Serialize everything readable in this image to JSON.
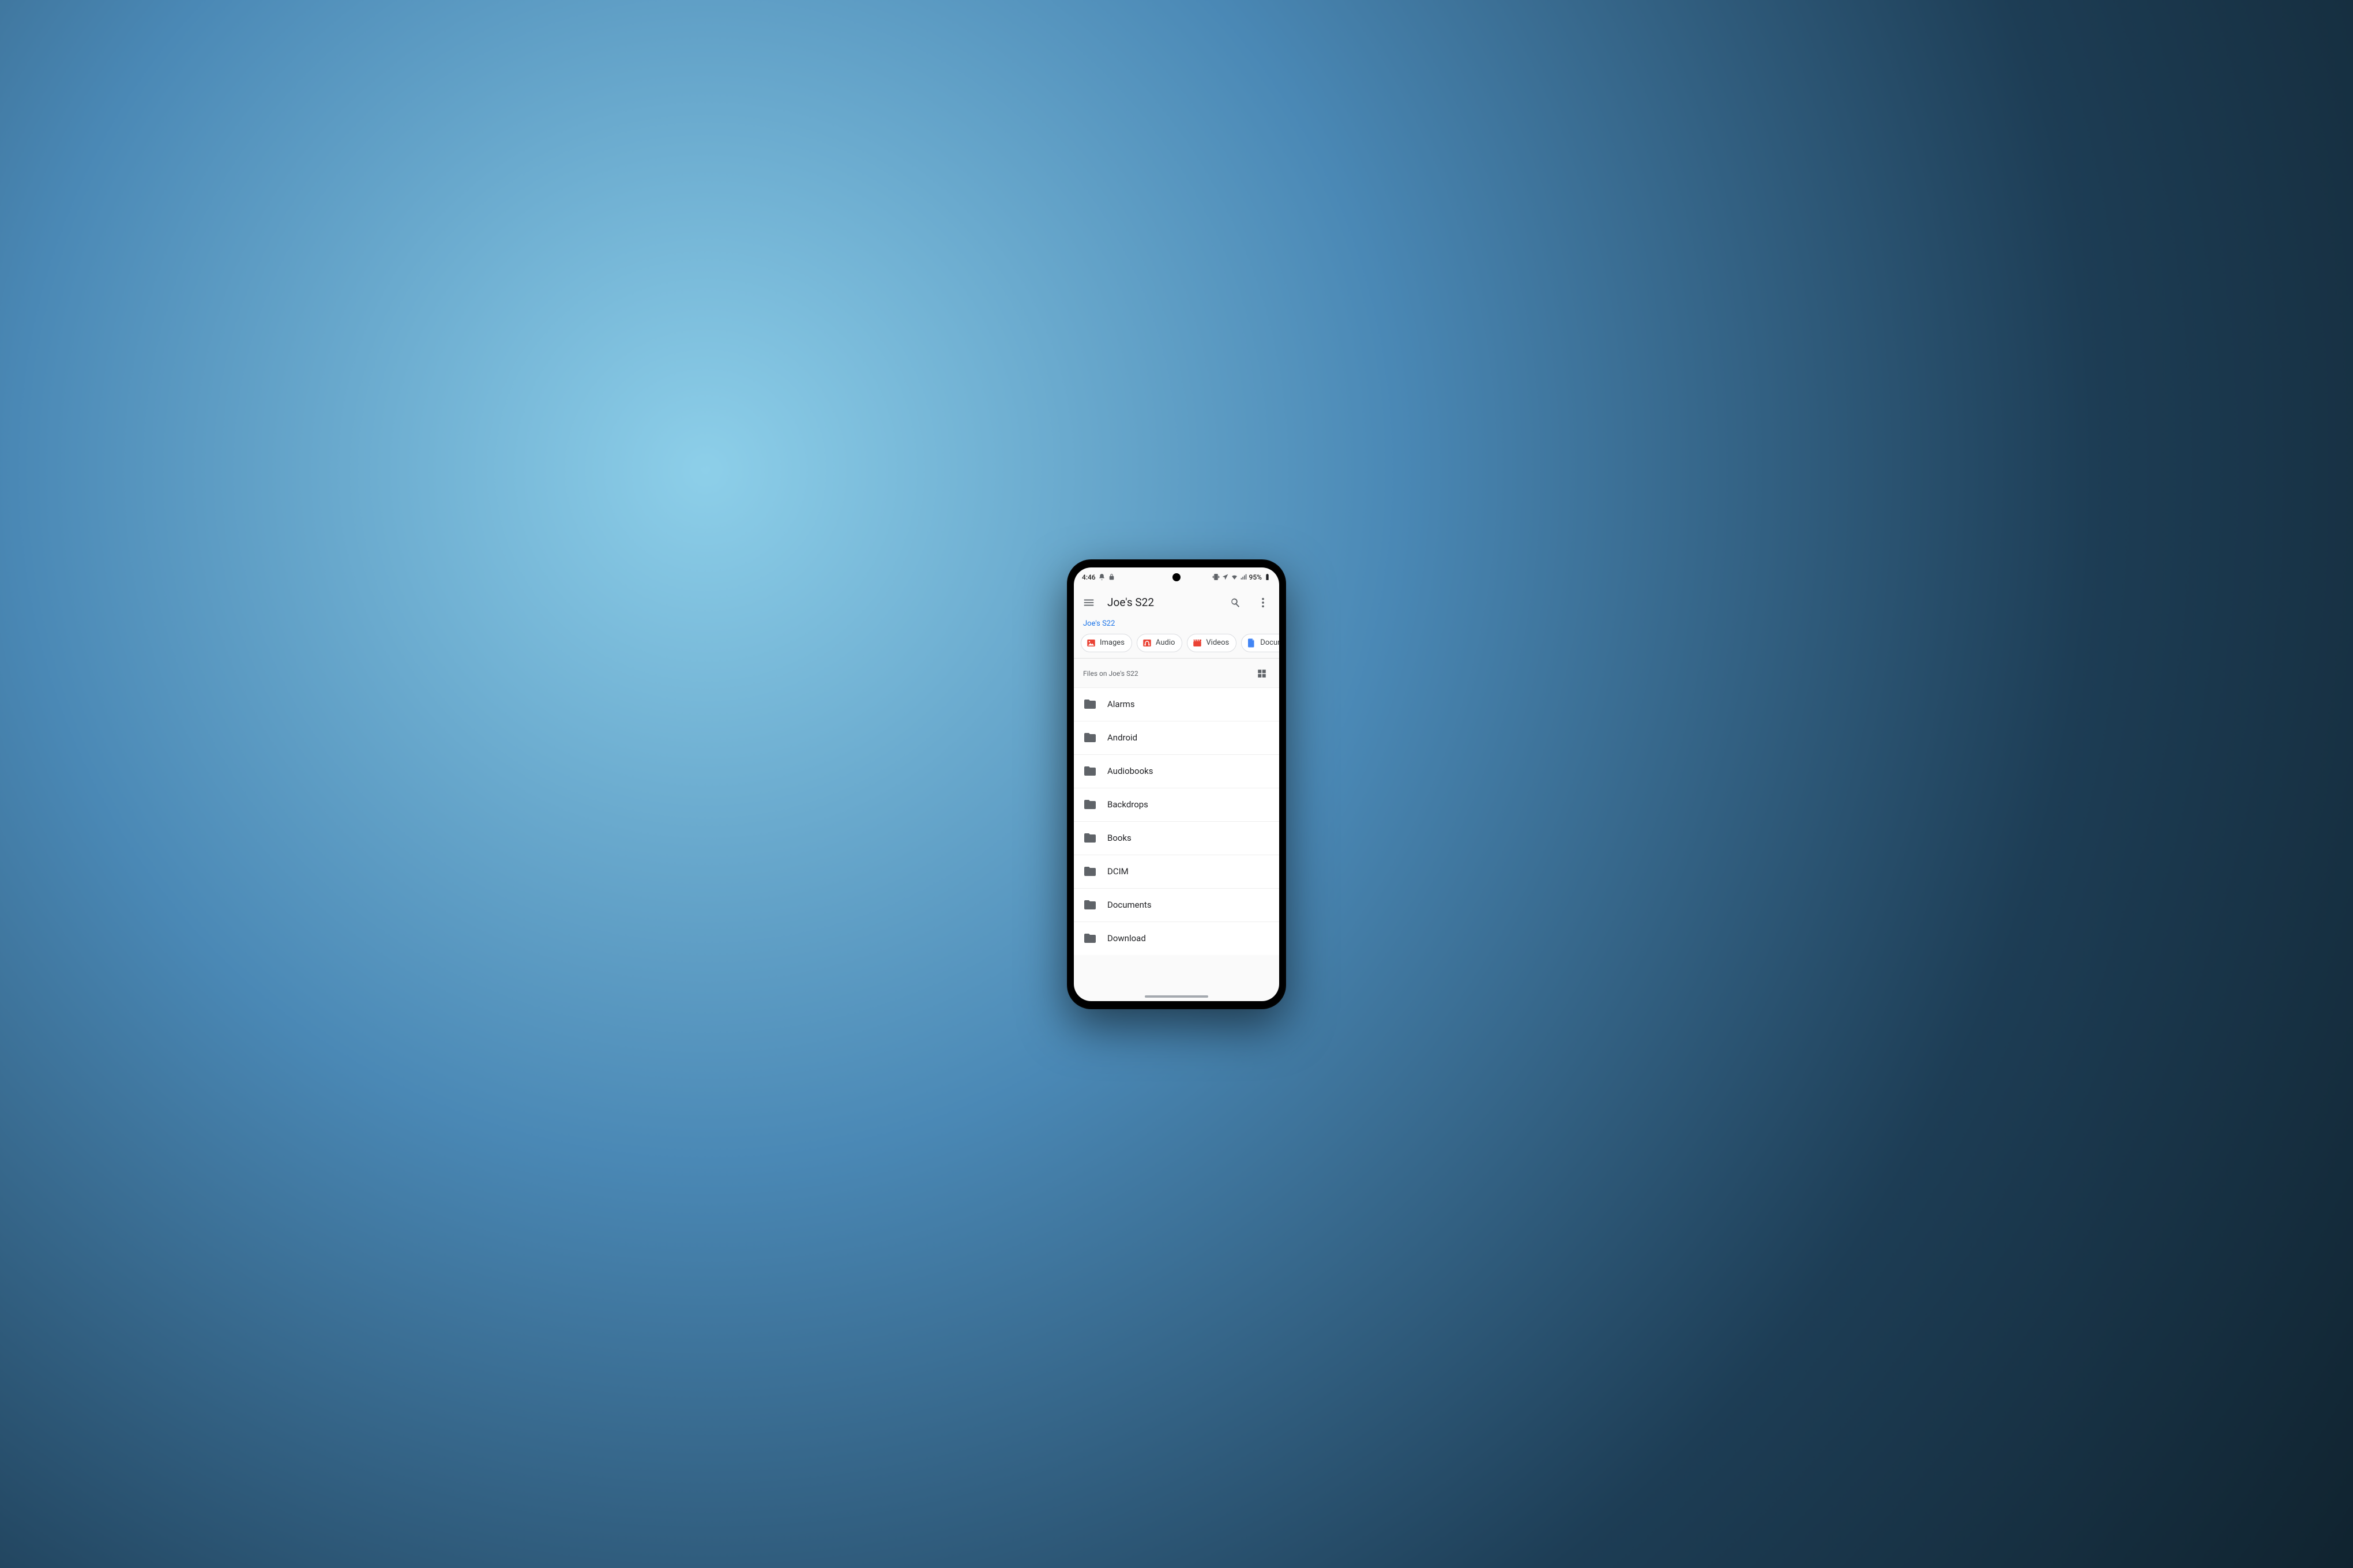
{
  "status_bar": {
    "time": "4:46",
    "battery_pct": "95%"
  },
  "app_bar": {
    "title": "Joe's S22"
  },
  "breadcrumb": {
    "root": "Joe's S22"
  },
  "chips": [
    {
      "label": "Images",
      "icon": "image",
      "color": "#ea4335"
    },
    {
      "label": "Audio",
      "icon": "audio",
      "color": "#ea4335"
    },
    {
      "label": "Videos",
      "icon": "video",
      "color": "#ea4335"
    },
    {
      "label": "Documents",
      "icon": "doc",
      "color": "#4285f4"
    }
  ],
  "section": {
    "title": "Files on Joe's S22"
  },
  "folders": [
    {
      "name": "Alarms"
    },
    {
      "name": "Android"
    },
    {
      "name": "Audiobooks"
    },
    {
      "name": "Backdrops"
    },
    {
      "name": "Books"
    },
    {
      "name": "DCIM"
    },
    {
      "name": "Documents"
    },
    {
      "name": "Download"
    }
  ]
}
